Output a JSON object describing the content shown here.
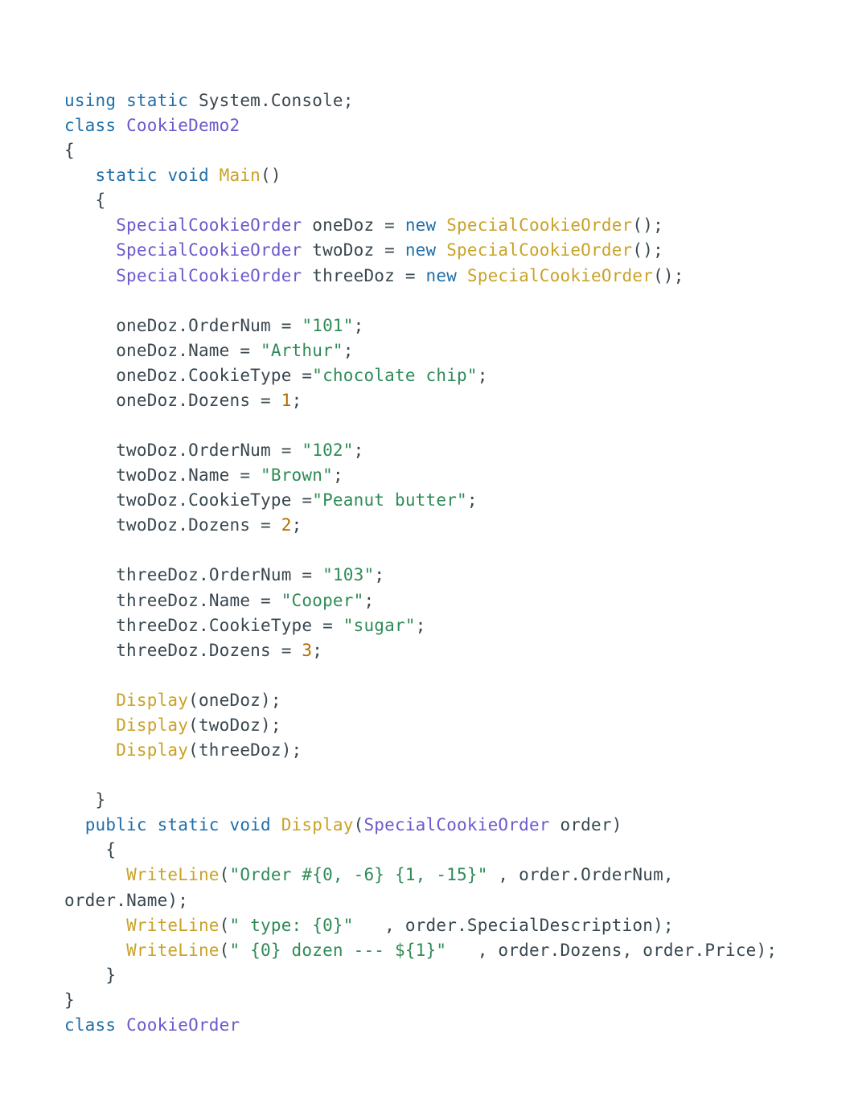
{
  "code": {
    "tokens": [
      {
        "cls": "kw",
        "t": "using"
      },
      {
        "cls": "pun",
        "t": " "
      },
      {
        "cls": "kw",
        "t": "static"
      },
      {
        "cls": "pun",
        "t": " System"
      },
      {
        "cls": "pun",
        "t": "."
      },
      {
        "cls": "pun",
        "t": "Console"
      },
      {
        "cls": "pun",
        "t": ";"
      },
      {
        "cls": "pun",
        "t": "\n"
      },
      {
        "cls": "kw",
        "t": "class"
      },
      {
        "cls": "pun",
        "t": " "
      },
      {
        "cls": "type",
        "t": "CookieDemo2"
      },
      {
        "cls": "pun",
        "t": "\n"
      },
      {
        "cls": "pun",
        "t": "{"
      },
      {
        "cls": "pun",
        "t": "\n"
      },
      {
        "cls": "pun",
        "t": "   "
      },
      {
        "cls": "kw",
        "t": "static"
      },
      {
        "cls": "pun",
        "t": " "
      },
      {
        "cls": "kw",
        "t": "void"
      },
      {
        "cls": "pun",
        "t": " "
      },
      {
        "cls": "fn",
        "t": "Main"
      },
      {
        "cls": "pun",
        "t": "()"
      },
      {
        "cls": "pun",
        "t": "\n"
      },
      {
        "cls": "pun",
        "t": "   {"
      },
      {
        "cls": "pun",
        "t": "\n"
      },
      {
        "cls": "pun",
        "t": "     "
      },
      {
        "cls": "type",
        "t": "SpecialCookieOrder"
      },
      {
        "cls": "pun",
        "t": " oneDoz "
      },
      {
        "cls": "pun",
        "t": "="
      },
      {
        "cls": "pun",
        "t": " "
      },
      {
        "cls": "kw",
        "t": "new"
      },
      {
        "cls": "pun",
        "t": " "
      },
      {
        "cls": "fn",
        "t": "SpecialCookieOrder"
      },
      {
        "cls": "pun",
        "t": "();"
      },
      {
        "cls": "pun",
        "t": "\n"
      },
      {
        "cls": "pun",
        "t": "     "
      },
      {
        "cls": "type",
        "t": "SpecialCookieOrder"
      },
      {
        "cls": "pun",
        "t": " twoDoz "
      },
      {
        "cls": "pun",
        "t": "="
      },
      {
        "cls": "pun",
        "t": " "
      },
      {
        "cls": "kw",
        "t": "new"
      },
      {
        "cls": "pun",
        "t": " "
      },
      {
        "cls": "fn",
        "t": "SpecialCookieOrder"
      },
      {
        "cls": "pun",
        "t": "();"
      },
      {
        "cls": "pun",
        "t": "\n"
      },
      {
        "cls": "pun",
        "t": "     "
      },
      {
        "cls": "type",
        "t": "SpecialCookieOrder"
      },
      {
        "cls": "pun",
        "t": " threeDoz "
      },
      {
        "cls": "pun",
        "t": "="
      },
      {
        "cls": "pun",
        "t": " "
      },
      {
        "cls": "kw",
        "t": "new"
      },
      {
        "cls": "pun",
        "t": " "
      },
      {
        "cls": "fn",
        "t": "SpecialCookieOrder"
      },
      {
        "cls": "pun",
        "t": "();"
      },
      {
        "cls": "pun",
        "t": "\n"
      },
      {
        "cls": "pun",
        "t": "\n"
      },
      {
        "cls": "pun",
        "t": "     oneDoz"
      },
      {
        "cls": "pun",
        "t": "."
      },
      {
        "cls": "pun",
        "t": "OrderNum "
      },
      {
        "cls": "pun",
        "t": "="
      },
      {
        "cls": "pun",
        "t": " "
      },
      {
        "cls": "str",
        "t": "\"101\""
      },
      {
        "cls": "pun",
        "t": ";"
      },
      {
        "cls": "pun",
        "t": "\n"
      },
      {
        "cls": "pun",
        "t": "     oneDoz"
      },
      {
        "cls": "pun",
        "t": "."
      },
      {
        "cls": "pun",
        "t": "Name "
      },
      {
        "cls": "pun",
        "t": "="
      },
      {
        "cls": "pun",
        "t": " "
      },
      {
        "cls": "str",
        "t": "\"Arthur\""
      },
      {
        "cls": "pun",
        "t": ";"
      },
      {
        "cls": "pun",
        "t": "\n"
      },
      {
        "cls": "pun",
        "t": "     oneDoz"
      },
      {
        "cls": "pun",
        "t": "."
      },
      {
        "cls": "pun",
        "t": "CookieType "
      },
      {
        "cls": "pun",
        "t": "="
      },
      {
        "cls": "str",
        "t": "\"chocolate chip\""
      },
      {
        "cls": "pun",
        "t": ";"
      },
      {
        "cls": "pun",
        "t": "\n"
      },
      {
        "cls": "pun",
        "t": "     oneDoz"
      },
      {
        "cls": "pun",
        "t": "."
      },
      {
        "cls": "pun",
        "t": "Dozens "
      },
      {
        "cls": "pun",
        "t": "="
      },
      {
        "cls": "pun",
        "t": " "
      },
      {
        "cls": "num",
        "t": "1"
      },
      {
        "cls": "pun",
        "t": ";"
      },
      {
        "cls": "pun",
        "t": "\n"
      },
      {
        "cls": "pun",
        "t": "\n"
      },
      {
        "cls": "pun",
        "t": "     twoDoz"
      },
      {
        "cls": "pun",
        "t": "."
      },
      {
        "cls": "pun",
        "t": "OrderNum "
      },
      {
        "cls": "pun",
        "t": "="
      },
      {
        "cls": "pun",
        "t": " "
      },
      {
        "cls": "str",
        "t": "\"102\""
      },
      {
        "cls": "pun",
        "t": ";"
      },
      {
        "cls": "pun",
        "t": "\n"
      },
      {
        "cls": "pun",
        "t": "     twoDoz"
      },
      {
        "cls": "pun",
        "t": "."
      },
      {
        "cls": "pun",
        "t": "Name "
      },
      {
        "cls": "pun",
        "t": "="
      },
      {
        "cls": "pun",
        "t": " "
      },
      {
        "cls": "str",
        "t": "\"Brown\""
      },
      {
        "cls": "pun",
        "t": ";"
      },
      {
        "cls": "pun",
        "t": "\n"
      },
      {
        "cls": "pun",
        "t": "     twoDoz"
      },
      {
        "cls": "pun",
        "t": "."
      },
      {
        "cls": "pun",
        "t": "CookieType "
      },
      {
        "cls": "pun",
        "t": "="
      },
      {
        "cls": "str",
        "t": "\"Peanut butter\""
      },
      {
        "cls": "pun",
        "t": ";"
      },
      {
        "cls": "pun",
        "t": "\n"
      },
      {
        "cls": "pun",
        "t": "     twoDoz"
      },
      {
        "cls": "pun",
        "t": "."
      },
      {
        "cls": "pun",
        "t": "Dozens "
      },
      {
        "cls": "pun",
        "t": "="
      },
      {
        "cls": "pun",
        "t": " "
      },
      {
        "cls": "num",
        "t": "2"
      },
      {
        "cls": "pun",
        "t": ";"
      },
      {
        "cls": "pun",
        "t": "\n"
      },
      {
        "cls": "pun",
        "t": "\n"
      },
      {
        "cls": "pun",
        "t": "     threeDoz"
      },
      {
        "cls": "pun",
        "t": "."
      },
      {
        "cls": "pun",
        "t": "OrderNum "
      },
      {
        "cls": "pun",
        "t": "="
      },
      {
        "cls": "pun",
        "t": " "
      },
      {
        "cls": "str",
        "t": "\"103\""
      },
      {
        "cls": "pun",
        "t": ";"
      },
      {
        "cls": "pun",
        "t": "\n"
      },
      {
        "cls": "pun",
        "t": "     threeDoz"
      },
      {
        "cls": "pun",
        "t": "."
      },
      {
        "cls": "pun",
        "t": "Name "
      },
      {
        "cls": "pun",
        "t": "="
      },
      {
        "cls": "pun",
        "t": " "
      },
      {
        "cls": "str",
        "t": "\"Cooper\""
      },
      {
        "cls": "pun",
        "t": ";"
      },
      {
        "cls": "pun",
        "t": "\n"
      },
      {
        "cls": "pun",
        "t": "     threeDoz"
      },
      {
        "cls": "pun",
        "t": "."
      },
      {
        "cls": "pun",
        "t": "CookieType "
      },
      {
        "cls": "pun",
        "t": "="
      },
      {
        "cls": "pun",
        "t": " "
      },
      {
        "cls": "str",
        "t": "\"sugar\""
      },
      {
        "cls": "pun",
        "t": ";"
      },
      {
        "cls": "pun",
        "t": "\n"
      },
      {
        "cls": "pun",
        "t": "     threeDoz"
      },
      {
        "cls": "pun",
        "t": "."
      },
      {
        "cls": "pun",
        "t": "Dozens "
      },
      {
        "cls": "pun",
        "t": "="
      },
      {
        "cls": "pun",
        "t": " "
      },
      {
        "cls": "num",
        "t": "3"
      },
      {
        "cls": "pun",
        "t": ";"
      },
      {
        "cls": "pun",
        "t": "\n"
      },
      {
        "cls": "pun",
        "t": "\n"
      },
      {
        "cls": "pun",
        "t": "     "
      },
      {
        "cls": "fn",
        "t": "Display"
      },
      {
        "cls": "pun",
        "t": "(oneDoz);"
      },
      {
        "cls": "pun",
        "t": "\n"
      },
      {
        "cls": "pun",
        "t": "     "
      },
      {
        "cls": "fn",
        "t": "Display"
      },
      {
        "cls": "pun",
        "t": "(twoDoz);"
      },
      {
        "cls": "pun",
        "t": "\n"
      },
      {
        "cls": "pun",
        "t": "     "
      },
      {
        "cls": "fn",
        "t": "Display"
      },
      {
        "cls": "pun",
        "t": "(threeDoz);"
      },
      {
        "cls": "pun",
        "t": "\n"
      },
      {
        "cls": "pun",
        "t": "\n"
      },
      {
        "cls": "pun",
        "t": "   }"
      },
      {
        "cls": "pun",
        "t": "\n"
      },
      {
        "cls": "pun",
        "t": "  "
      },
      {
        "cls": "kw",
        "t": "public"
      },
      {
        "cls": "pun",
        "t": " "
      },
      {
        "cls": "kw",
        "t": "static"
      },
      {
        "cls": "pun",
        "t": " "
      },
      {
        "cls": "kw",
        "t": "void"
      },
      {
        "cls": "pun",
        "t": " "
      },
      {
        "cls": "fn",
        "t": "Display"
      },
      {
        "cls": "pun",
        "t": "("
      },
      {
        "cls": "type",
        "t": "SpecialCookieOrder"
      },
      {
        "cls": "pun",
        "t": " order)"
      },
      {
        "cls": "pun",
        "t": "\n"
      },
      {
        "cls": "pun",
        "t": "    {"
      },
      {
        "cls": "pun",
        "t": "\n"
      },
      {
        "cls": "pun",
        "t": "      "
      },
      {
        "cls": "fn",
        "t": "WriteLine"
      },
      {
        "cls": "pun",
        "t": "("
      },
      {
        "cls": "str",
        "t": "\"Order #{0, -6} {1, -15}\""
      },
      {
        "cls": "pun",
        "t": " "
      },
      {
        "cls": "pun",
        "t": ","
      },
      {
        "cls": "pun",
        "t": " order"
      },
      {
        "cls": "pun",
        "t": "."
      },
      {
        "cls": "pun",
        "t": "OrderNum"
      },
      {
        "cls": "pun",
        "t": ","
      },
      {
        "cls": "pun",
        "t": " order"
      },
      {
        "cls": "pun",
        "t": "."
      },
      {
        "cls": "pun",
        "t": "Name);"
      },
      {
        "cls": "pun",
        "t": "\n"
      },
      {
        "cls": "pun",
        "t": "      "
      },
      {
        "cls": "fn",
        "t": "WriteLine"
      },
      {
        "cls": "pun",
        "t": "("
      },
      {
        "cls": "str",
        "t": "\" type: {0}\""
      },
      {
        "cls": "pun",
        "t": "   "
      },
      {
        "cls": "pun",
        "t": ","
      },
      {
        "cls": "pun",
        "t": " order"
      },
      {
        "cls": "pun",
        "t": "."
      },
      {
        "cls": "pun",
        "t": "SpecialDescription);"
      },
      {
        "cls": "pun",
        "t": "\n"
      },
      {
        "cls": "pun",
        "t": "      "
      },
      {
        "cls": "fn",
        "t": "WriteLine"
      },
      {
        "cls": "pun",
        "t": "("
      },
      {
        "cls": "str",
        "t": "\" {0} dozen --- ${1}\""
      },
      {
        "cls": "pun",
        "t": "   "
      },
      {
        "cls": "pun",
        "t": ","
      },
      {
        "cls": "pun",
        "t": " order"
      },
      {
        "cls": "pun",
        "t": "."
      },
      {
        "cls": "pun",
        "t": "Dozens"
      },
      {
        "cls": "pun",
        "t": ","
      },
      {
        "cls": "pun",
        "t": " order"
      },
      {
        "cls": "pun",
        "t": "."
      },
      {
        "cls": "pun",
        "t": "Price);"
      },
      {
        "cls": "pun",
        "t": "\n"
      },
      {
        "cls": "pun",
        "t": "    }"
      },
      {
        "cls": "pun",
        "t": "\n"
      },
      {
        "cls": "pun",
        "t": "}"
      },
      {
        "cls": "pun",
        "t": "\n"
      },
      {
        "cls": "kw",
        "t": "class"
      },
      {
        "cls": "pun",
        "t": " "
      },
      {
        "cls": "type",
        "t": "CookieOrder"
      }
    ]
  }
}
